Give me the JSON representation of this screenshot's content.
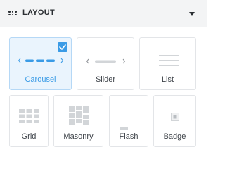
{
  "header": {
    "title": "LAYOUT",
    "grip_icon": "grip-dots-icon",
    "toggle_icon": "caret-down-icon"
  },
  "options": [
    {
      "id": "carousel",
      "label": "Carousel",
      "selected": true,
      "icon": "carousel-icon"
    },
    {
      "id": "slider",
      "label": "Slider",
      "selected": false,
      "icon": "slider-icon"
    },
    {
      "id": "list",
      "label": "List",
      "selected": false,
      "icon": "list-icon"
    },
    {
      "id": "grid",
      "label": "Grid",
      "selected": false,
      "icon": "grid-icon"
    },
    {
      "id": "masonry",
      "label": "Masonry",
      "selected": false,
      "icon": "masonry-icon"
    },
    {
      "id": "flash",
      "label": "Flash",
      "selected": false,
      "icon": "flash-icon"
    },
    {
      "id": "badge",
      "label": "Badge",
      "selected": false,
      "icon": "badge-icon"
    }
  ],
  "colors": {
    "accent": "#3a9be6",
    "icon_gray": "#d2d5d8",
    "header_bg": "#f3f4f5"
  }
}
